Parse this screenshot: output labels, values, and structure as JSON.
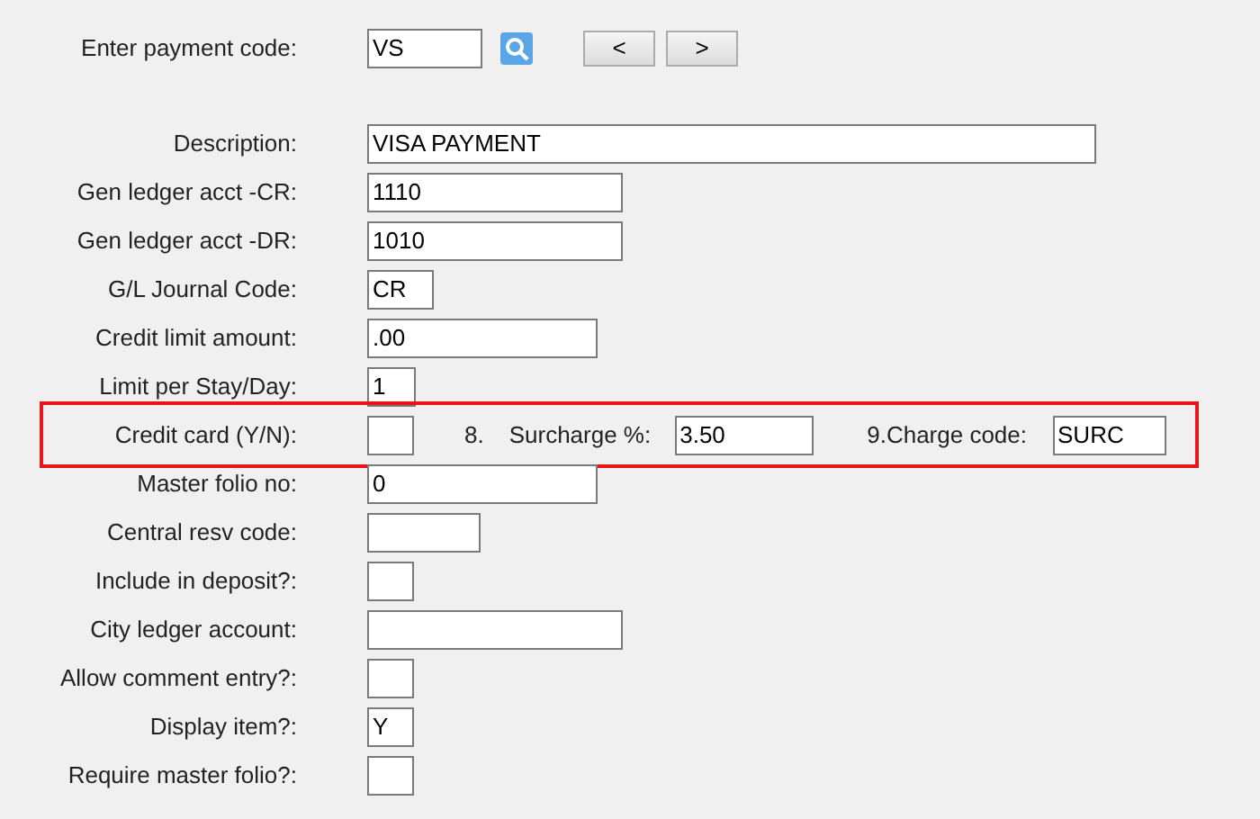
{
  "lookup": {
    "label": "Enter payment code:",
    "value": "VS",
    "buttons": [
      "<",
      ">"
    ]
  },
  "rows": [
    {
      "label": "Description:",
      "value": "VISA PAYMENT",
      "highlighted": false
    },
    {
      "label": "Gen ledger acct -CR:",
      "value": "1110",
      "highlighted": false
    },
    {
      "label": "Gen ledger acct -DR:",
      "value": "1010",
      "highlighted": false
    },
    {
      "label": "G/L Journal Code:",
      "value": "CR",
      "highlighted": false
    },
    {
      "label": "Credit limit amount:",
      "value": ".00",
      "highlighted": false
    },
    {
      "label": "Limit per Stay/Day:",
      "value": "1",
      "highlighted": false
    },
    {
      "label": "Credit card (Y/N):",
      "highlighted": true,
      "extras": [
        {
          "kind": "text",
          "text": "8."
        },
        {
          "kind": "text",
          "text": "Surcharge %:"
        },
        {
          "kind": "field",
          "value": "3.50"
        },
        {
          "kind": "text",
          "text": "9.Charge code:"
        },
        {
          "kind": "field",
          "value": "SURC"
        }
      ]
    },
    {
      "label": "Master folio no:",
      "value": "0",
      "highlighted": false
    },
    {
      "label": "Central resv code:",
      "highlighted": false
    },
    {
      "label": "Include in deposit?:",
      "highlighted": false
    },
    {
      "label": "City ledger account:",
      "highlighted": false
    },
    {
      "label": "Allow comment entry?:",
      "highlighted": false
    },
    {
      "label": "Display item?:",
      "value": "Y",
      "highlighted": false
    },
    {
      "label": "Require master folio?:",
      "highlighted": false
    }
  ]
}
